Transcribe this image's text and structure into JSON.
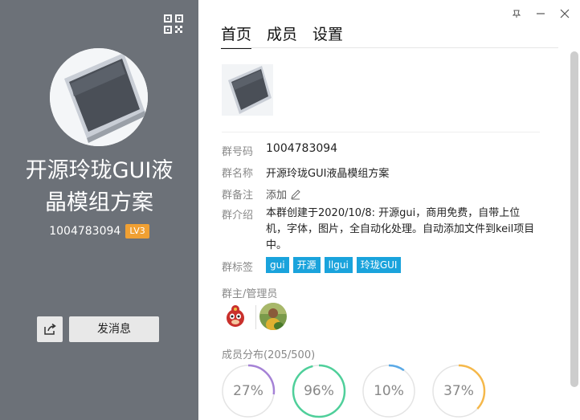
{
  "profile": {
    "title": "开源玲珑GUI液晶模组方案",
    "title_line1": "开源玲珑GUI液",
    "title_line2": "晶模组方案",
    "group_id": "1004783094",
    "level": "LV3",
    "send_message_label": "发消息"
  },
  "icons": {
    "qr": "qr-code-icon",
    "share": "share-icon",
    "pin": "pin-icon",
    "minimize": "minimize-icon",
    "close": "close-icon",
    "edit": "pencil-icon"
  },
  "tabs": [
    {
      "label": "首页",
      "active": true
    },
    {
      "label": "成员",
      "active": false
    },
    {
      "label": "设置",
      "active": false
    }
  ],
  "info": {
    "group_number_label": "群号码",
    "group_number": "1004783094",
    "group_name_label": "群名称",
    "group_name": "开源玲珑GUI液晶模组方案",
    "remark_label": "群备注",
    "remark_action": "添加",
    "intro_label": "群介绍",
    "intro": "本群创建于2020/10/8: 开源gui，商用免费，自带上位机，字体，图片，全自动化处理。自动添加文件到keil项目中。",
    "tags_label": "群标签",
    "tags": [
      "gui",
      "开源",
      "llgui",
      "玲珑GUI"
    ]
  },
  "admins": {
    "title": "群主/管理员",
    "count": 2
  },
  "distribution": {
    "title": "成员分布",
    "count_text": "(205/500)",
    "stats": [
      {
        "label": "27%",
        "value": 0.27,
        "color": "#a582d6"
      },
      {
        "label": "96%",
        "value": 0.96,
        "color": "#4fcf9a"
      },
      {
        "label": "10%",
        "value": 0.1,
        "color": "#5aa9e6"
      },
      {
        "label": "37%",
        "value": 0.37,
        "color": "#f5b84a"
      }
    ]
  },
  "colors": {
    "left_panel": "#6c7178",
    "level_badge": "#f0a033",
    "tag_bg": "#1aa3dc",
    "ring_track": "#e4e4e4"
  }
}
